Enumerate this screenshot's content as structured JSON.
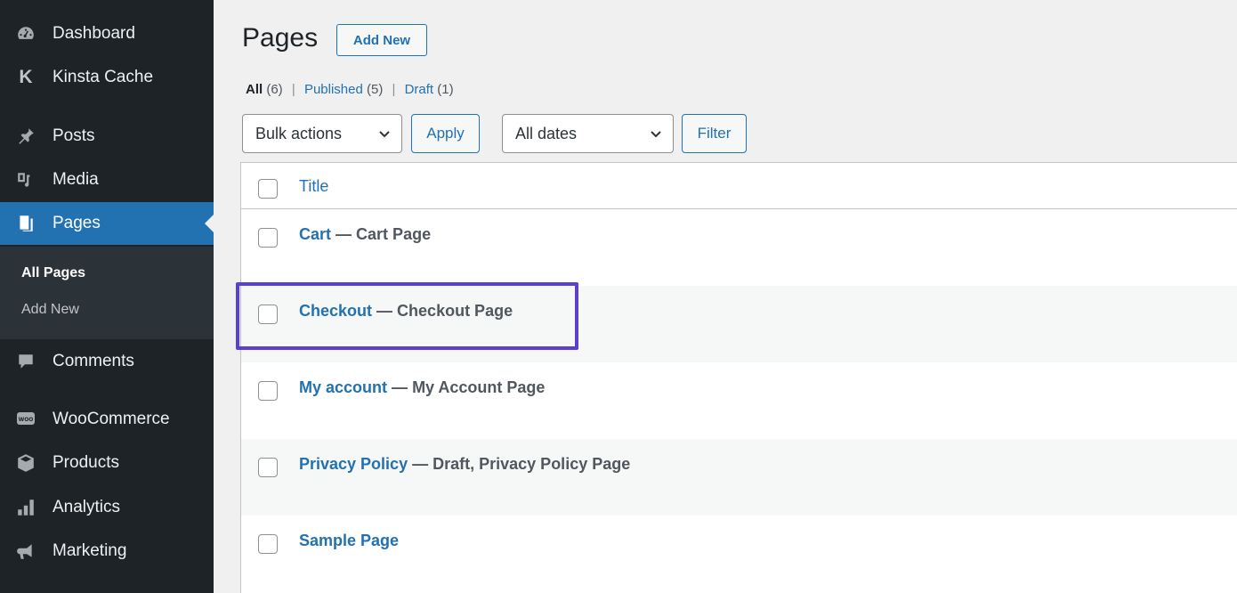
{
  "sidebar": {
    "items": [
      {
        "label": "Dashboard",
        "icon": "dashboard-icon"
      },
      {
        "label": "Kinsta Cache",
        "icon": "kinsta-icon"
      },
      {
        "label": "Posts",
        "icon": "pin-icon"
      },
      {
        "label": "Media",
        "icon": "media-icon"
      },
      {
        "label": "Pages",
        "icon": "pages-icon",
        "current": true
      },
      {
        "label": "Comments",
        "icon": "comment-icon"
      },
      {
        "label": "WooCommerce",
        "icon": "woo-icon"
      },
      {
        "label": "Products",
        "icon": "box-icon"
      },
      {
        "label": "Analytics",
        "icon": "bar-chart-icon"
      },
      {
        "label": "Marketing",
        "icon": "megaphone-icon"
      }
    ],
    "submenu": [
      {
        "label": "All Pages",
        "current": true
      },
      {
        "label": "Add New"
      }
    ],
    "kinsta_glyph": "K"
  },
  "header": {
    "title": "Pages",
    "add_new_label": "Add New"
  },
  "filters": {
    "all_label": "All",
    "all_count": "(6)",
    "published_label": "Published",
    "published_count": "(5)",
    "draft_label": "Draft",
    "draft_count": "(1)",
    "separator": "|"
  },
  "toolbar": {
    "bulk_actions": "Bulk actions",
    "apply_label": "Apply",
    "dates": "All dates",
    "filter_label": "Filter"
  },
  "table": {
    "title_header": "Title",
    "rows": [
      {
        "title": "Cart",
        "dash": "—",
        "state": "Cart Page"
      },
      {
        "title": "Checkout",
        "dash": "—",
        "state": "Checkout Page"
      },
      {
        "title": "My account",
        "dash": "—",
        "state": "My Account Page"
      },
      {
        "title": "Privacy Policy",
        "dash": "—",
        "state": "Draft, Privacy Policy Page"
      },
      {
        "title": "Sample Page",
        "dash": "",
        "state": ""
      }
    ]
  },
  "colors": {
    "sidebar_bg": "#1d2327",
    "accent": "#2271b1",
    "highlight": "#5b3fd1"
  }
}
